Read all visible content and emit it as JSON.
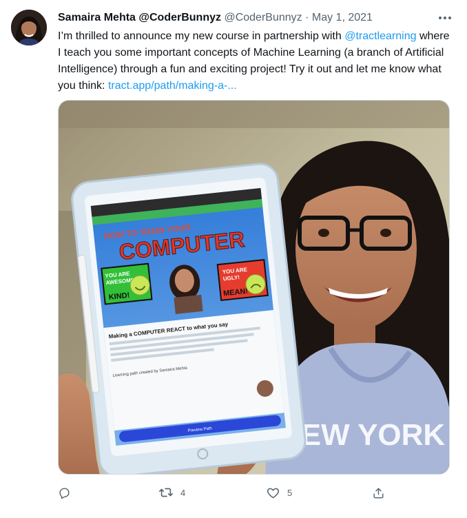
{
  "author": {
    "display_name": "Samaira Mehta",
    "handle_inline": "@CoderBunnyz",
    "handle": "@CoderBunnyz",
    "separator": "·",
    "date": "May 1, 2021"
  },
  "tweet": {
    "text_part1": "I’m thrilled to announce my new course in partnership with ",
    "mention": "@tractlearning",
    "text_part2": " where I teach you some important concepts of Machine Learning (a branch of Artificial Intelligence) through a fun and exciting project! Try it out and let me know what you think: ",
    "link": "tract.app/path/making-a-..."
  },
  "media": {
    "tablet_screen": {
      "headline_top": "HOW TO TRAIN YOUR",
      "headline_main": "COMPUTER",
      "green_badge_line1": "YOU ARE",
      "green_badge_line2": "AWESOME!",
      "green_badge_word": "KIND!",
      "red_badge_line1": "YOU ARE",
      "red_badge_line2": "UGLY!",
      "red_badge_word": "MEAN!",
      "course_title": "Making a COMPUTER REACT to what you say",
      "created_by": "Learning path created by Samaira Mehta",
      "button": "Preview Path"
    },
    "hoodie_text": "NEW YORK"
  },
  "actions": {
    "reply_count": "",
    "retweet_count": "4",
    "like_count": "5"
  },
  "colors": {
    "accent": "#1d9bf0",
    "muted": "#536471"
  }
}
